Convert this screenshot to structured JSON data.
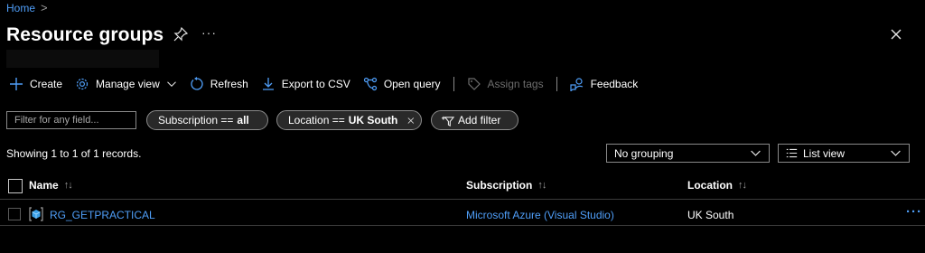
{
  "breadcrumb": {
    "home": "Home",
    "separator": ">"
  },
  "page": {
    "title": "Resource groups",
    "more": "···"
  },
  "toolbar": {
    "create": "Create",
    "manage_view": "Manage view",
    "refresh": "Refresh",
    "export_csv": "Export to CSV",
    "open_query": "Open query",
    "assign_tags": "Assign tags",
    "feedback": "Feedback"
  },
  "filters": {
    "search_placeholder": "Filter for any field...",
    "subscription_label": "Subscription ==",
    "subscription_value": "all",
    "location_label": "Location ==",
    "location_value": "UK South",
    "add_filter": "Add filter"
  },
  "records": "Showing 1 to 1 of 1 records.",
  "grouping": {
    "selected": "No grouping"
  },
  "view": {
    "selected": "List view"
  },
  "table": {
    "columns": [
      "Name",
      "Subscription",
      "Location"
    ],
    "rows": [
      {
        "name": "RG_GETPRACTICAL",
        "subscription": "Microsoft Azure (Visual Studio)",
        "location": "UK South"
      }
    ],
    "row_more": "···"
  },
  "colors": {
    "accent": "#4f9ef8",
    "background": "#000000",
    "disabled": "#6d6d6d"
  }
}
